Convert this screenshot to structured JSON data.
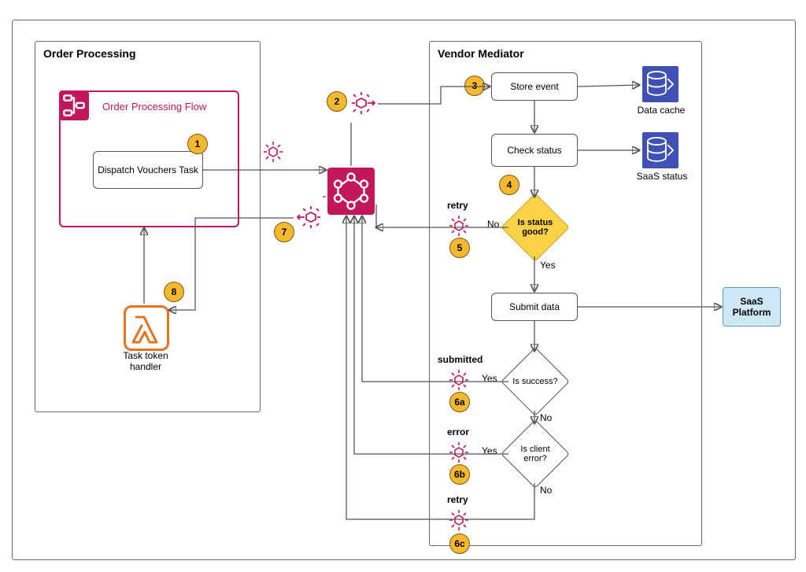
{
  "frames": {
    "order_processing_title": "Order Processing",
    "vendor_mediator_title": "Vendor Mediator"
  },
  "order_flow": {
    "title": "Order Processing Flow",
    "task": "Dispatch Vouchers Task"
  },
  "vendor": {
    "store_event": "Store event",
    "check_status": "Check status",
    "is_status_good": "Is status good?",
    "submit_data": "Submit data",
    "is_success": "Is success?",
    "is_client_error": "Is client error?"
  },
  "external": {
    "data_cache": "Data cache",
    "saas_status": "SaaS status",
    "saas_platform": "SaaS Platform"
  },
  "handlers": {
    "task_token_handler": "Task token handler"
  },
  "edge_labels": {
    "retry": "retry",
    "submitted": "submitted",
    "error": "error",
    "yes": "Yes",
    "no": "No"
  },
  "steps": {
    "s1": "1",
    "s2": "2",
    "s3": "3",
    "s4": "4",
    "s5": "5",
    "s6a": "6a",
    "s6b": "6b",
    "s6c": "6c",
    "s7": "7",
    "s8": "8"
  }
}
